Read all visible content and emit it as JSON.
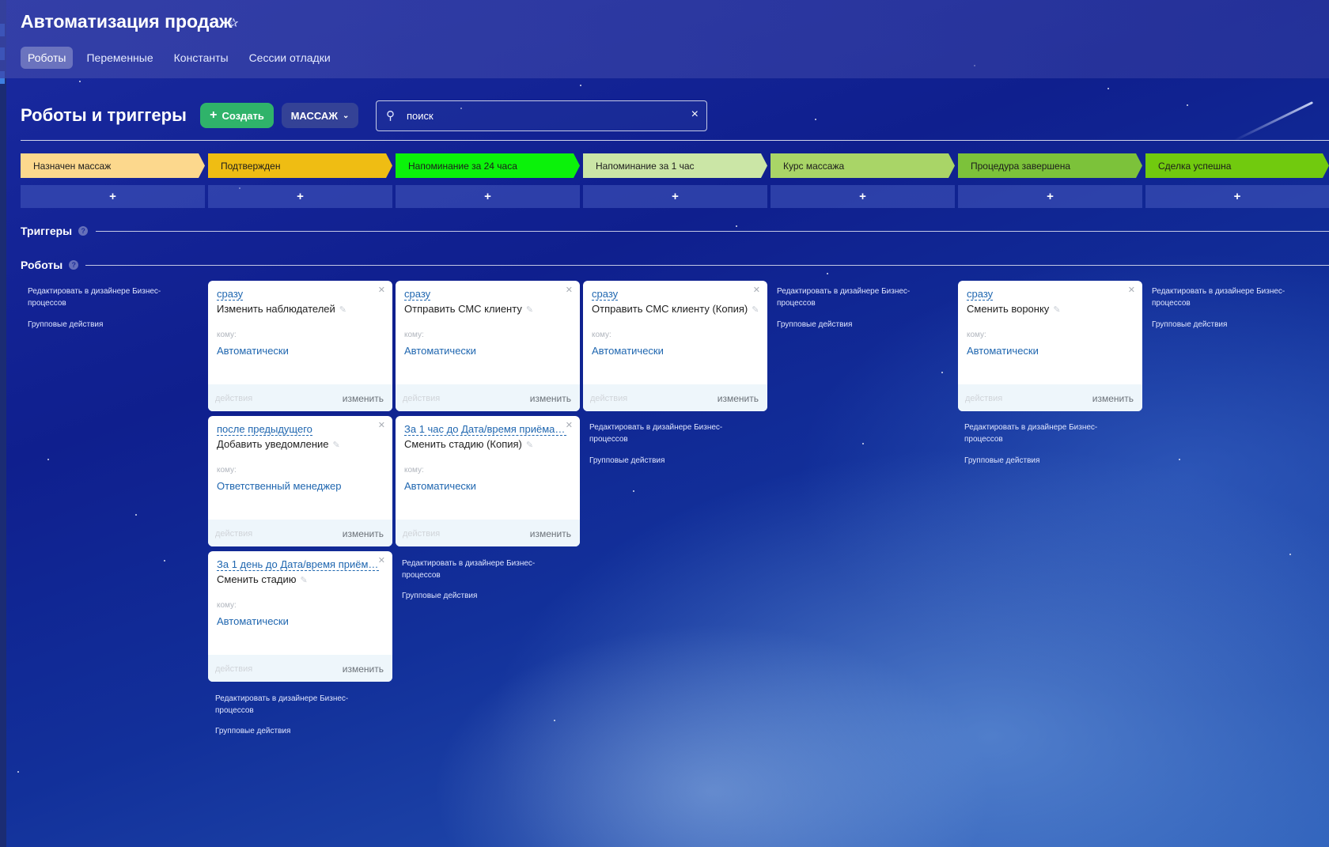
{
  "header": {
    "title": "Автоматизация продаж",
    "tabs": [
      {
        "label": "Роботы",
        "active": true
      },
      {
        "label": "Переменные",
        "active": false
      },
      {
        "label": "Константы",
        "active": false
      },
      {
        "label": "Сессии отладки",
        "active": false
      }
    ]
  },
  "toolbar": {
    "heading": "Роботы и триггеры",
    "create_label": "Создать",
    "funnel_label": "МАССАЖ",
    "search_value": "поиск"
  },
  "stages": [
    {
      "label": "Назначен массаж",
      "color": "#fcd88d"
    },
    {
      "label": "Подтвержден",
      "color": "#efbd13"
    },
    {
      "label": "Напоминание за 24 часа",
      "color": "#0bf20a"
    },
    {
      "label": "Напоминание за 1 час",
      "color": "#cbe6a6"
    },
    {
      "label": "Курс массажа",
      "color": "#a9d567"
    },
    {
      "label": "Процедура завершена",
      "color": "#7cc23a"
    },
    {
      "label": "Сделка успешна",
      "color": "#71ca0e"
    }
  ],
  "add_symbol": "+",
  "sections": {
    "triggers": "Триггеры",
    "robots": "Роботы"
  },
  "common": {
    "to_label": "кому:",
    "actions_label": "действия",
    "change_label": "изменить",
    "edit_designer": "Редактировать в дизайнере Бизнес-процессов",
    "edit_designer_line1": "Редактировать в дизайнере Бизнес-",
    "edit_designer_line2": "процессов",
    "group_actions": "Групповые действия"
  },
  "robots": [
    {
      "column": 1,
      "when": "сразу",
      "name": "Изменить наблюдателей",
      "to": "Автоматически"
    },
    {
      "column": 1,
      "when": "после предыдущего",
      "name": "Добавить уведомление",
      "to": "Ответственный менеджер"
    },
    {
      "column": 1,
      "when": "За 1 день до Дата/время приёма...",
      "name": "Сменить стадию",
      "to": "Автоматически"
    },
    {
      "column": 2,
      "when": "сразу",
      "name": "Отправить СМС клиенту",
      "to": "Автоматически"
    },
    {
      "column": 2,
      "when": "За 1 час до Дата/время приёма, ...",
      "name": "Сменить стадию (Копия)",
      "to": "Автоматически"
    },
    {
      "column": 3,
      "when": "сразу",
      "name": "Отправить СМС клиенту (Копия)",
      "to": "Автоматически"
    },
    {
      "column": 5,
      "when": "сразу",
      "name": "Сменить воронку",
      "to": "Автоматически"
    }
  ]
}
